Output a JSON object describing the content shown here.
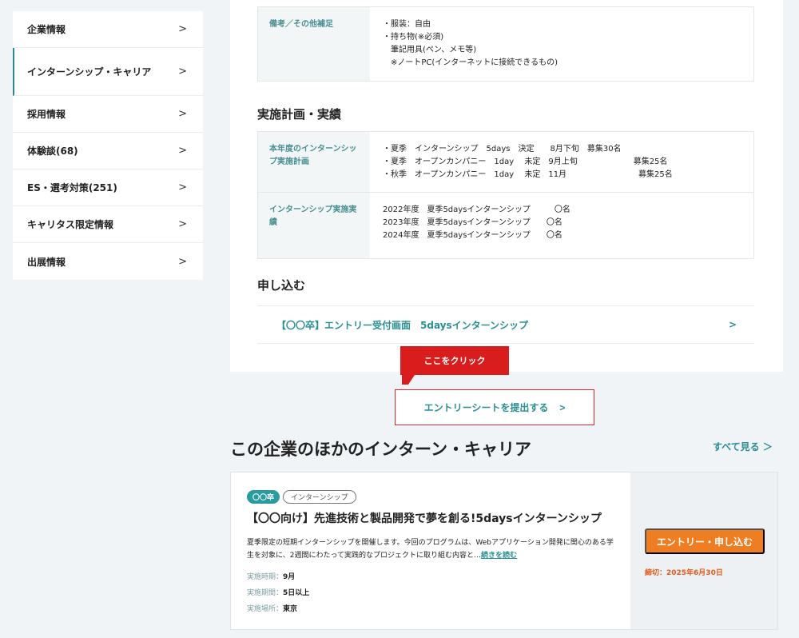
{
  "sidebar": {
    "items": [
      {
        "label": "企業情報"
      },
      {
        "label": "インターンシップ・キャリア"
      },
      {
        "label": "採用情報"
      },
      {
        "label": "体験談(68)"
      },
      {
        "label": "ES・選考対策(251)"
      },
      {
        "label": "キャリタス限定情報"
      },
      {
        "label": "出展情報"
      }
    ],
    "chevron": ">"
  },
  "notes": {
    "label": "備考／その他補足",
    "lines": [
      "・服装：自由",
      "・持ち物(※必須)",
      "　筆記用具(ペン、メモ等)",
      "　※ノートPC(インターネットに接続できるもの)"
    ]
  },
  "plan": {
    "section_title": "実施計画・実績",
    "rows": [
      {
        "label": "本年度のインターンシップ実施計画",
        "lines": [
          "・夏季　インターンシップ　5days　決定　　8月下旬　募集30名",
          "・夏季　オープンカンパニー　1day　 未定　9月上旬　　　　　　　募集25名",
          "・秋季　オープンカンパニー　1day　 未定　11月　　　　　　　　　募集25名"
        ]
      },
      {
        "label": "インターンシップ実施実績",
        "lines": [
          "2022年度　夏季5daysインターンシップ　　　〇名",
          "2023年度　夏季5daysインターンシップ　　〇名",
          "2024年度　夏季5daysインターンシップ　　〇名"
        ]
      }
    ]
  },
  "apply": {
    "section_title": "申し込む",
    "link_label": "【〇〇卒】エントリー受付画面　5daysインターンシップ",
    "chevron": ">"
  },
  "tooltip": "ここをクリック",
  "es_button": {
    "label": "エントリーシートを提出する",
    "chevron": ">"
  },
  "other": {
    "title": "この企業のほかのインターン・キャリア",
    "see_all": "すべて見る ＞"
  },
  "card": {
    "badge_year": "〇〇卒",
    "badge_type": "インターンシップ",
    "title": "【〇〇向け】先進技術と製品開発で夢を創る!5daysインターンシップ",
    "description": "夏季限定の短期インターンシップを開催します。今回のプログラムは、Webアプリケーション開発に関心のある学生を対象に、2週間にわたって実践的なプロジェクトに取り組む内容と",
    "read_more": "続きを読む",
    "meta": [
      {
        "k": "実施時期：",
        "v": "9月"
      },
      {
        "k": "実施期間：",
        "v": "5日以上"
      },
      {
        "k": "実施場所：",
        "v": "東京"
      }
    ],
    "entry_button": "エントリー・申し込む",
    "deadline": "締切：2025年6月30日"
  },
  "colors": {
    "accent": "#2a8f94",
    "highlight_red": "#d91d1d",
    "entry_orange": "#ef7d22"
  }
}
